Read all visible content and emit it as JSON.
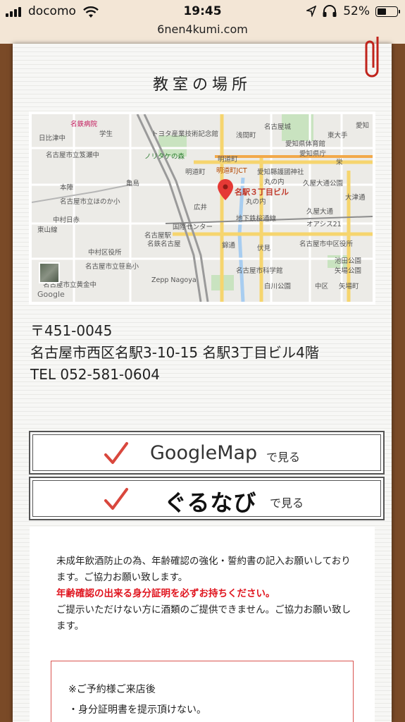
{
  "status_bar": {
    "carrier": "docomo",
    "time": "19:45",
    "battery": "52%",
    "battery_level": 0.52,
    "url": "6nen4kumi.com"
  },
  "section_title": "教室の場所",
  "map": {
    "pin_label": "名駅３丁目ビル",
    "labels": [
      "名鉄病院",
      "学生",
      "トヨタ産業技術記念館",
      "浅間町",
      "名古屋城",
      "東大手",
      "日比津中",
      "名古屋市立笈瀬中",
      "ノリタケの森",
      "明道町",
      "愛知県体育館",
      "愛知県庁",
      "愛知",
      "明道町JCT",
      "愛知縣護國神社",
      "本陣",
      "亀島",
      "名駅３丁目ビル",
      "丸の内",
      "久屋大通公園",
      "名古屋市立ほのか小",
      "丸の内",
      "大津通",
      "中村日赤",
      "久屋大通",
      "国際センター",
      "地下鉄桜通線",
      "名古屋駅",
      "オアシス21",
      "名鉄名古屋",
      "錦通",
      "伏見",
      "名古屋市中区役所",
      "中村区役所",
      "名古屋市立笹島小",
      "池田公園",
      "名古屋市科学館",
      "矢場公園",
      "名古屋市立黄金中",
      "Zepp Nagoya",
      "白川公園",
      "中区",
      "矢場町",
      "Google",
      "東山線",
      "明道町",
      "栄",
      "広井"
    ]
  },
  "address": {
    "postal": "〒451-0045",
    "street": "名古屋市西区名駅3-10-15 名駅3丁目ビル4階",
    "tel": "TEL 052-581-0604"
  },
  "buttons": {
    "google_label": "GoogleMap",
    "google_sub": "で見る",
    "gurunavi_label": "ぐるなび",
    "gurunavi_sub": "で見る"
  },
  "notice": {
    "line1": "未成年飲酒防止の為、年齢確認の強化・誓約書の記入お願いしております。ご協力お願い致します。",
    "line2_red": "年齢確認の出来る身分証明を必ずお持ちください。",
    "line3": "ご提示いただけない方に酒類のご提供できません。ご協力お願い致します。",
    "box_line1": "※ご予約様ご来店後",
    "box_line2": "・身分証明書を提示頂けない。"
  },
  "colors": {
    "wood": "#7a4a27",
    "status_bg": "#f3e6d6",
    "accent_red": "#e0141e",
    "check_red": "#d9473d"
  }
}
